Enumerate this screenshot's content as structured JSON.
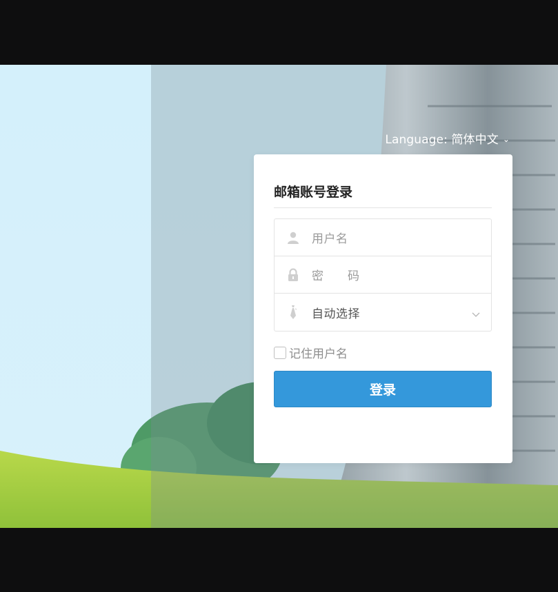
{
  "language": {
    "prefix": "Language:",
    "value": "简体中文"
  },
  "login": {
    "title": "邮箱账号登录",
    "username_placeholder": "用户名",
    "password_placeholder": "密　码",
    "domain_select": {
      "selected": "自动选择"
    },
    "remember_label": "记住用户名",
    "checked": false,
    "submit_label": "登录"
  },
  "icons": {
    "username": "user-icon",
    "password": "lock-icon",
    "domain": "tie-icon",
    "dropdown": "chevron-down-icon",
    "language": "chevron-down-icon"
  },
  "colors": {
    "primary_button": "#3498db",
    "card_background": "#ffffff",
    "letterbox": "#0e0e0f"
  }
}
